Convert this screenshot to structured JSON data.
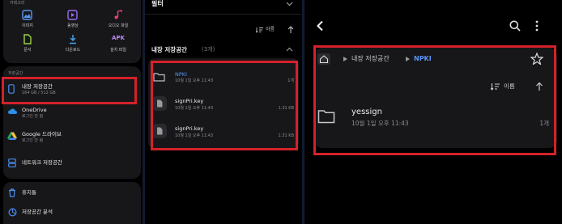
{
  "left": {
    "header": "카테고리",
    "categories": [
      {
        "label": "이미지",
        "icon": "image-icon"
      },
      {
        "label": "동영상",
        "icon": "video-icon"
      },
      {
        "label": "오디오 파일",
        "icon": "audio-icon"
      },
      {
        "label": "문서",
        "icon": "document-icon"
      },
      {
        "label": "다운로드",
        "icon": "download-icon"
      },
      {
        "label": "설치 파일",
        "icon": "apk-icon"
      }
    ],
    "apk_glyph": "APK",
    "storage_header": "저장공간",
    "storage": [
      {
        "title": "내장 저장공간",
        "sub": "164 GB / 512 GB"
      },
      {
        "title": "OneDrive",
        "sub": "로그인 안 됨"
      },
      {
        "title": "Google 드라이브",
        "sub": "로그인 안 됨"
      },
      {
        "title": "네트워크 저장공간",
        "sub": ""
      }
    ],
    "trash": "휴지통",
    "analysis": "저장공간 분석"
  },
  "middle": {
    "filter": "필터",
    "sort": "이름",
    "section": "내장 저장공간",
    "count": "(3개)",
    "files": [
      {
        "name": "NPKI",
        "date": "10월 1일 오후 11:43",
        "meta": "1개",
        "type": "folder"
      },
      {
        "name": "signPri.key",
        "date": "10월 1일 오후 11:43",
        "meta": "1.31 KB",
        "type": "file"
      },
      {
        "name": "signPri.key",
        "date": "10월 1일 오후 11:43",
        "meta": "1.31 KB",
        "type": "file"
      }
    ]
  },
  "right": {
    "breadcrumb": [
      "내장 저장공간",
      "NPKI"
    ],
    "sort": "이름",
    "folder": {
      "name": "yessign",
      "date": "10월 1일 오후 11:43",
      "count": "1개"
    }
  },
  "colors": {
    "highlight": "#d4212a",
    "accent": "#5a95f0",
    "bg": "#000000",
    "card": "#17171a"
  }
}
